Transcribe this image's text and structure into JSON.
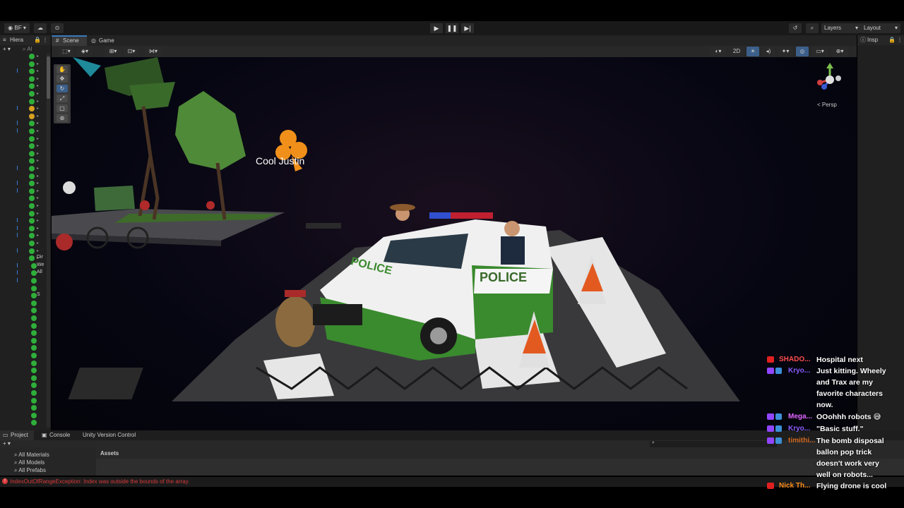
{
  "topbar": {
    "account": "BF",
    "layers": "Layers",
    "layout": "Layout"
  },
  "hierarchy": {
    "tab": "Hiera",
    "search_placeholder": "Al",
    "item_labels": [
      "Dir",
      "We",
      "All",
      "S"
    ]
  },
  "scene_view": {
    "tabs": [
      "Scene",
      "Game"
    ],
    "mode_2d": "2D",
    "persp_label": "< Persp",
    "character_name": "Cool Justin",
    "car_hood_text": "POLICE",
    "car_door_text": "POLICE"
  },
  "inspector": {
    "tab": "Insp"
  },
  "bottom": {
    "tabs": [
      "Project",
      "Console",
      "Unity Version Control"
    ],
    "project_items": [
      "All Materials",
      "All Models",
      "All Prefabs"
    ],
    "assets_label": "Assets",
    "error": "IndexOutOfRangeException: Index was outside the bounds of the array."
  },
  "chat": [
    {
      "platform": "youtube",
      "name": "SHADO...",
      "name_color": "#ff4d4d",
      "message": "Hospital next"
    },
    {
      "platform": "twitch",
      "name": "Kryo...",
      "name_color": "#8a5cff",
      "message": "Just kitting. Wheely and Trax are my favorite characters now."
    },
    {
      "platform": "twitch",
      "name": "Mega...",
      "name_color": "#e066ff",
      "message": "OOohhh robots 😅"
    },
    {
      "platform": "twitch",
      "name": "Kryo...",
      "name_color": "#8a5cff",
      "message": "\"Basic stuff.\""
    },
    {
      "platform": "twitch",
      "name": "timithi...",
      "name_color": "#d2691e",
      "message": "The bomb disposal ballon pop trick doesn't work very well on robots..."
    },
    {
      "platform": "youtube",
      "name": "Nick Th...",
      "name_color": "#ff8c1a",
      "message": "Flying drone is cool"
    }
  ],
  "colors": {
    "check_green": "#2fae3a",
    "youtube_red": "#e02020",
    "twitch_purple": "#9146ff",
    "error_red": "#d83a3a",
    "car_green": "#3a8a2e"
  }
}
